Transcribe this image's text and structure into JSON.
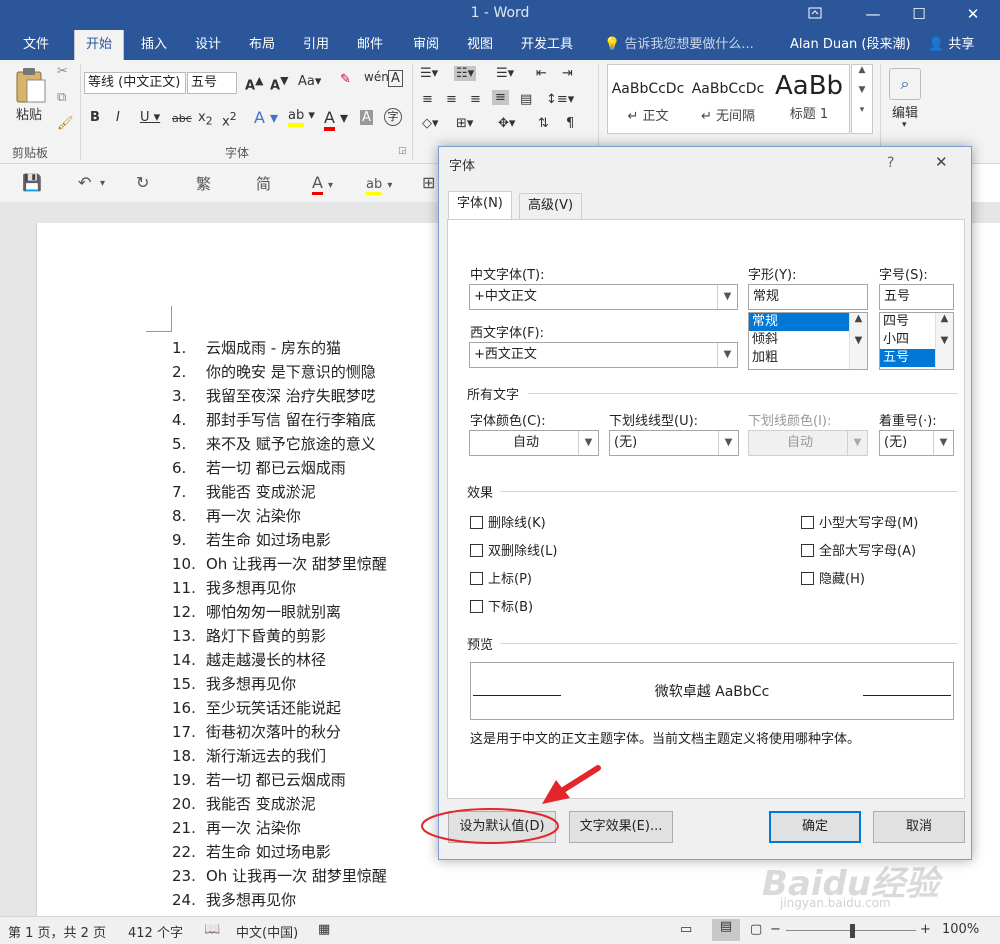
{
  "window": {
    "title": "1 - Word",
    "ribbon_display_icon": "ribbon-display-icon",
    "minimize_icon": "minimize-icon",
    "maximize_icon": "maximize-icon",
    "close_icon": "close-icon"
  },
  "tabs": [
    "文件",
    "开始",
    "插入",
    "设计",
    "布局",
    "引用",
    "邮件",
    "审阅",
    "视图",
    "开发工具"
  ],
  "active_tab": "开始",
  "tell_me": "告诉我您想要做什么...",
  "user_name": "Alan Duan (段来潮)",
  "share_label": "共享",
  "ribbon": {
    "clipboard_label": "剪贴板",
    "paste_label": "粘贴",
    "font_group_label": "字体",
    "font_name": "等线 (中文正文)",
    "font_size": "五号",
    "change_case": "Aa",
    "styles": [
      {
        "preview": "AaBbCcDc",
        "name": "正文"
      },
      {
        "preview": "AaBbCcDc",
        "name": "无间隔"
      },
      {
        "preview": "AaBb",
        "name": "标题 1"
      }
    ],
    "editing_label": "编辑",
    "qat_trad": "繁",
    "qat_simp": "简"
  },
  "document": {
    "lines": [
      {
        "num": "1.",
        "text": "云烟成雨 - 房东的猫"
      },
      {
        "num": "2.",
        "text": "你的晚安 是下意识的恻隐"
      },
      {
        "num": "3.",
        "text": "我留至夜深 治疗失眠梦呓"
      },
      {
        "num": "4.",
        "text": "那封手写信 留在行李箱底"
      },
      {
        "num": "5.",
        "text": "来不及 赋予它旅途的意义"
      },
      {
        "num": "6.",
        "text": "若一切 都已云烟成雨"
      },
      {
        "num": "7.",
        "text": "我能否 变成淤泥"
      },
      {
        "num": "8.",
        "text": "再一次 沾染你"
      },
      {
        "num": "9.",
        "text": "若生命 如过场电影"
      },
      {
        "num": "10.",
        "text": "Oh 让我再一次 甜梦里惊醒"
      },
      {
        "num": "11.",
        "text": "我多想再见你"
      },
      {
        "num": "12.",
        "text": "哪怕匆匆一眼就别离"
      },
      {
        "num": "13.",
        "text": "路灯下昏黄的剪影"
      },
      {
        "num": "14.",
        "text": "越走越漫长的林径"
      },
      {
        "num": "15.",
        "text": "我多想再见你"
      },
      {
        "num": "16.",
        "text": "至少玩笑话还能说起"
      },
      {
        "num": "17.",
        "text": "街巷初次落叶的秋分"
      },
      {
        "num": "18.",
        "text": "渐行渐远去的我们"
      },
      {
        "num": "19.",
        "text": "若一切 都已云烟成雨"
      },
      {
        "num": "20.",
        "text": "我能否 变成淤泥"
      },
      {
        "num": "21.",
        "text": "再一次 沾染你"
      },
      {
        "num": "22.",
        "text": "若生命 如过场电影"
      },
      {
        "num": "23.",
        "text": "Oh 让我再一次 甜梦里惊醒"
      },
      {
        "num": "24.",
        "text": "我多想再见你"
      }
    ]
  },
  "status": {
    "page": "第 1 页，共 2 页",
    "words": "412 个字",
    "language": "中文(中国)",
    "zoom": "100%"
  },
  "dialog": {
    "title": "字体",
    "help": "?",
    "close": "✕",
    "tab_font": "字体(N)",
    "tab_advanced": "高级(V)",
    "cn_font_label": "中文字体(T):",
    "cn_font_value": "+中文正文",
    "west_font_label": "西文字体(F):",
    "west_font_value": "+西文正文",
    "style_label": "字形(Y):",
    "style_value": "常规",
    "style_options": [
      "常规",
      "倾斜",
      "加粗"
    ],
    "size_label": "字号(S):",
    "size_value": "五号",
    "size_options": [
      "四号",
      "小四",
      "五号"
    ],
    "all_text_section": "所有文字",
    "font_color_label": "字体颜色(C):",
    "font_color_value": "自动",
    "underline_style_label": "下划线线型(U):",
    "underline_style_value": "(无)",
    "underline_color_label": "下划线颜色(I):",
    "underline_color_value": "自动",
    "emphasis_label": "着重号(·):",
    "emphasis_value": "(无)",
    "effects_section": "效果",
    "effects_left": [
      "删除线(K)",
      "双删除线(L)",
      "上标(P)",
      "下标(B)"
    ],
    "effects_right": [
      "小型大写字母(M)",
      "全部大写字母(A)",
      "隐藏(H)"
    ],
    "preview_section": "预览",
    "preview_text": "微软卓越  AaBbCc",
    "preview_desc": "这是用于中文的正文主题字体。当前文档主题定义将使用哪种字体。",
    "btn_default": "设为默认值(D)",
    "btn_effects": "文字效果(E)...",
    "btn_ok": "确定",
    "btn_cancel": "取消"
  },
  "annotation": {
    "circle_color": "#e3262b",
    "arrow_color": "#e3262b"
  },
  "watermark": "Baidu经验",
  "watermark_url": "jingyan.baidu.com"
}
